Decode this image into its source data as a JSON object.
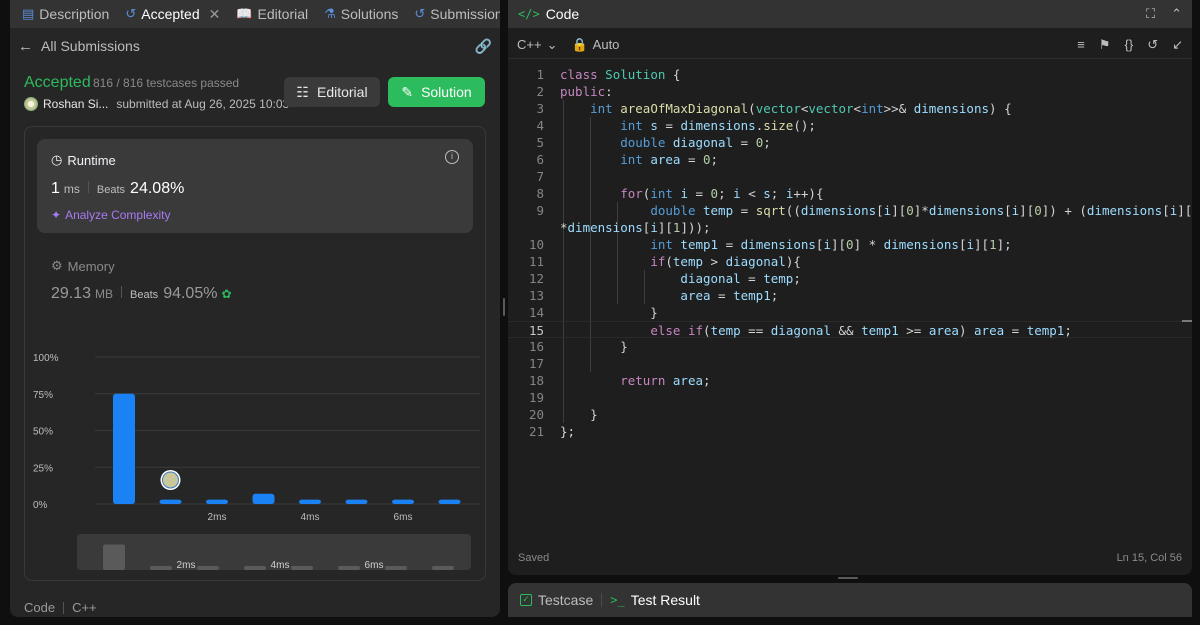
{
  "left_tabs": [
    {
      "label": "Description",
      "icon": "document-icon",
      "active": false
    },
    {
      "label": "Accepted",
      "icon": "history-icon",
      "active": true
    },
    {
      "label": "Editorial",
      "icon": "book-icon",
      "active": false
    },
    {
      "label": "Solutions",
      "icon": "flask-icon",
      "active": false
    },
    {
      "label": "Submissions",
      "icon": "history-icon",
      "active": false
    }
  ],
  "back_label": "All Submissions",
  "status": {
    "label": "Accepted",
    "testcases": "816 / 816 testcases passed",
    "user": "Roshan Si...",
    "submitted": "submitted at Aug 26, 2025 10:03"
  },
  "buttons": {
    "editorial": "Editorial",
    "solution": "Solution"
  },
  "runtime": {
    "title": "Runtime",
    "value": "1",
    "unit": "ms",
    "beats_label": "Beats",
    "beats": "24.08%",
    "analyze": "Analyze Complexity"
  },
  "memory": {
    "title": "Memory",
    "value": "29.13",
    "unit": "MB",
    "beats_label": "Beats",
    "beats": "94.05%"
  },
  "chart_data": {
    "type": "bar",
    "title": "",
    "xlabel": "",
    "ylabel": "",
    "ylim": [
      0,
      100
    ],
    "yticks": [
      "100%",
      "75%",
      "50%",
      "25%",
      "0%"
    ],
    "xtick_labels": [
      "2ms",
      "4ms",
      "6ms"
    ],
    "values": [
      75,
      3,
      3,
      7,
      3,
      3,
      3,
      3
    ],
    "highlight_index": 1,
    "minimap_values": [
      75,
      3,
      3,
      7,
      3,
      3,
      3,
      3
    ]
  },
  "code_footer": {
    "label": "Code",
    "lang": "C++"
  },
  "editor": {
    "title": "Code",
    "language": "C++",
    "mode": "Auto",
    "saved": "Saved",
    "cursor": "Ln 15, Col 56",
    "lines": [
      "1",
      "2",
      "3",
      "4",
      "5",
      "6",
      "7",
      "8",
      "9",
      "",
      "10",
      "11",
      "12",
      "13",
      "14",
      "15",
      "16",
      "17",
      "18",
      "19",
      "20",
      "21"
    ]
  },
  "bottom_tabs": [
    {
      "label": "Testcase",
      "active": false
    },
    {
      "label": "Test Result",
      "active": true
    }
  ]
}
